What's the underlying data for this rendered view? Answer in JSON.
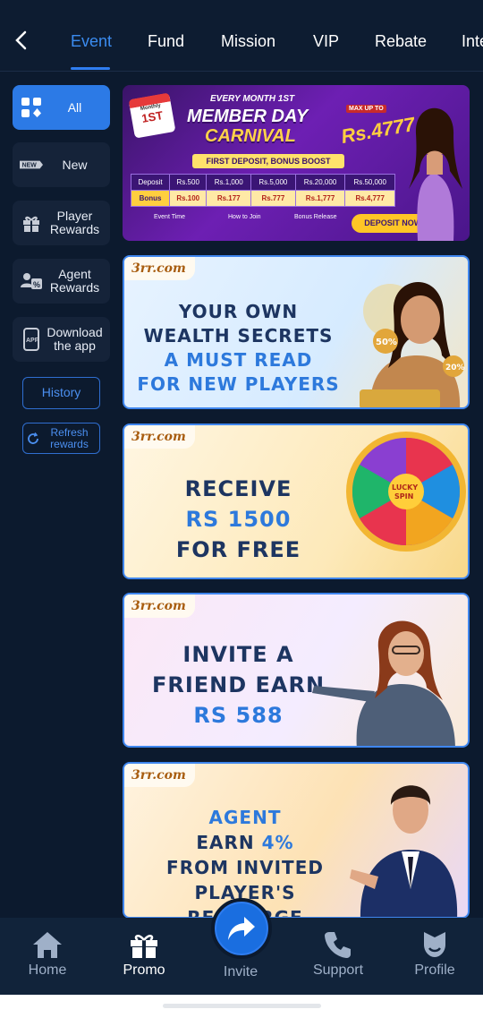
{
  "tabs": [
    "Event",
    "Fund",
    "Mission",
    "VIP",
    "Rebate",
    "Inte"
  ],
  "active_tab": "Event",
  "sidebar": {
    "items": [
      {
        "label": "All",
        "icon": "grid-icon",
        "active": true
      },
      {
        "label": "New",
        "icon": "new-badge-icon"
      },
      {
        "label": "Player Rewards",
        "icon": "gift-icon"
      },
      {
        "label": "Agent Rewards",
        "icon": "agent-icon"
      },
      {
        "label": "Download the app",
        "icon": "app-download-icon"
      }
    ],
    "history_label": "History",
    "refresh_label": "Refresh rewards"
  },
  "banner1": {
    "calendar_top": "Monthly",
    "calendar_day": "1ST",
    "top_line": "EVERY MONTH 1ST",
    "title_line1": "MEMBER DAY",
    "title_line2": "CARNIVAL",
    "max": "MAX UP TO",
    "max_amount": "Rs.4777",
    "subtitle": "FIRST DEPOSIT, BONUS BOOST",
    "deposit_row": [
      "Deposit",
      "Rs.500",
      "Rs.1,000",
      "Rs.5,000",
      "Rs.20,000",
      "Rs.50,000"
    ],
    "bonus_row": [
      "Bonus",
      "Rs.100",
      "Rs.177",
      "Rs.777",
      "Rs.1,777",
      "Rs.4,777"
    ],
    "footer": [
      "Event Time",
      "How to Join",
      "Bonus Release"
    ],
    "cta": "DEPOSIT NOW ›"
  },
  "brand": "3rr.com",
  "banner2": {
    "line1": "YOUR OWN",
    "line2": "WEALTH SECRETS",
    "line3": "A MUST READ",
    "line4": "FOR NEW PLAYERS",
    "coin1": "50%",
    "coin2": "20%"
  },
  "banner3": {
    "line1": "RECEIVE",
    "line2": "RS 1500",
    "line3": "FOR FREE",
    "wheel_center": "LUCKY SPIN"
  },
  "banner4": {
    "line1": "INVITE A",
    "line2": "FRIEND EARN",
    "line3": "RS 588"
  },
  "banner5": {
    "line1": "AGENT",
    "line2a": "EARN ",
    "line2b": "4%",
    "line3": "FROM INVITED",
    "line4": "PLAYER'S RECHARGE"
  },
  "bottom_nav": [
    "Home",
    "Promo",
    "Invite",
    "Support",
    "Profile"
  ],
  "current_nav": "Promo",
  "colors": {
    "accent": "#2f7df0",
    "background": "#0c1a2e",
    "panel": "#152339",
    "gold": "#ffcf3f"
  }
}
